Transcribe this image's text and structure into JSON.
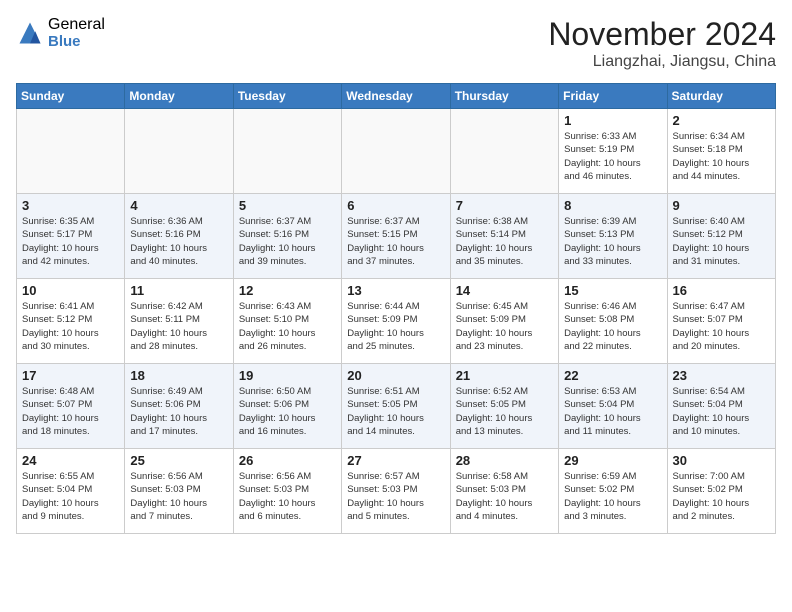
{
  "logo": {
    "general": "General",
    "blue": "Blue"
  },
  "header": {
    "month": "November 2024",
    "location": "Liangzhai, Jiangsu, China"
  },
  "days_of_week": [
    "Sunday",
    "Monday",
    "Tuesday",
    "Wednesday",
    "Thursday",
    "Friday",
    "Saturday"
  ],
  "weeks": [
    [
      {
        "day": "",
        "info": ""
      },
      {
        "day": "",
        "info": ""
      },
      {
        "day": "",
        "info": ""
      },
      {
        "day": "",
        "info": ""
      },
      {
        "day": "",
        "info": ""
      },
      {
        "day": "1",
        "info": "Sunrise: 6:33 AM\nSunset: 5:19 PM\nDaylight: 10 hours\nand 46 minutes."
      },
      {
        "day": "2",
        "info": "Sunrise: 6:34 AM\nSunset: 5:18 PM\nDaylight: 10 hours\nand 44 minutes."
      }
    ],
    [
      {
        "day": "3",
        "info": "Sunrise: 6:35 AM\nSunset: 5:17 PM\nDaylight: 10 hours\nand 42 minutes."
      },
      {
        "day": "4",
        "info": "Sunrise: 6:36 AM\nSunset: 5:16 PM\nDaylight: 10 hours\nand 40 minutes."
      },
      {
        "day": "5",
        "info": "Sunrise: 6:37 AM\nSunset: 5:16 PM\nDaylight: 10 hours\nand 39 minutes."
      },
      {
        "day": "6",
        "info": "Sunrise: 6:37 AM\nSunset: 5:15 PM\nDaylight: 10 hours\nand 37 minutes."
      },
      {
        "day": "7",
        "info": "Sunrise: 6:38 AM\nSunset: 5:14 PM\nDaylight: 10 hours\nand 35 minutes."
      },
      {
        "day": "8",
        "info": "Sunrise: 6:39 AM\nSunset: 5:13 PM\nDaylight: 10 hours\nand 33 minutes."
      },
      {
        "day": "9",
        "info": "Sunrise: 6:40 AM\nSunset: 5:12 PM\nDaylight: 10 hours\nand 31 minutes."
      }
    ],
    [
      {
        "day": "10",
        "info": "Sunrise: 6:41 AM\nSunset: 5:12 PM\nDaylight: 10 hours\nand 30 minutes."
      },
      {
        "day": "11",
        "info": "Sunrise: 6:42 AM\nSunset: 5:11 PM\nDaylight: 10 hours\nand 28 minutes."
      },
      {
        "day": "12",
        "info": "Sunrise: 6:43 AM\nSunset: 5:10 PM\nDaylight: 10 hours\nand 26 minutes."
      },
      {
        "day": "13",
        "info": "Sunrise: 6:44 AM\nSunset: 5:09 PM\nDaylight: 10 hours\nand 25 minutes."
      },
      {
        "day": "14",
        "info": "Sunrise: 6:45 AM\nSunset: 5:09 PM\nDaylight: 10 hours\nand 23 minutes."
      },
      {
        "day": "15",
        "info": "Sunrise: 6:46 AM\nSunset: 5:08 PM\nDaylight: 10 hours\nand 22 minutes."
      },
      {
        "day": "16",
        "info": "Sunrise: 6:47 AM\nSunset: 5:07 PM\nDaylight: 10 hours\nand 20 minutes."
      }
    ],
    [
      {
        "day": "17",
        "info": "Sunrise: 6:48 AM\nSunset: 5:07 PM\nDaylight: 10 hours\nand 18 minutes."
      },
      {
        "day": "18",
        "info": "Sunrise: 6:49 AM\nSunset: 5:06 PM\nDaylight: 10 hours\nand 17 minutes."
      },
      {
        "day": "19",
        "info": "Sunrise: 6:50 AM\nSunset: 5:06 PM\nDaylight: 10 hours\nand 16 minutes."
      },
      {
        "day": "20",
        "info": "Sunrise: 6:51 AM\nSunset: 5:05 PM\nDaylight: 10 hours\nand 14 minutes."
      },
      {
        "day": "21",
        "info": "Sunrise: 6:52 AM\nSunset: 5:05 PM\nDaylight: 10 hours\nand 13 minutes."
      },
      {
        "day": "22",
        "info": "Sunrise: 6:53 AM\nSunset: 5:04 PM\nDaylight: 10 hours\nand 11 minutes."
      },
      {
        "day": "23",
        "info": "Sunrise: 6:54 AM\nSunset: 5:04 PM\nDaylight: 10 hours\nand 10 minutes."
      }
    ],
    [
      {
        "day": "24",
        "info": "Sunrise: 6:55 AM\nSunset: 5:04 PM\nDaylight: 10 hours\nand 9 minutes."
      },
      {
        "day": "25",
        "info": "Sunrise: 6:56 AM\nSunset: 5:03 PM\nDaylight: 10 hours\nand 7 minutes."
      },
      {
        "day": "26",
        "info": "Sunrise: 6:56 AM\nSunset: 5:03 PM\nDaylight: 10 hours\nand 6 minutes."
      },
      {
        "day": "27",
        "info": "Sunrise: 6:57 AM\nSunset: 5:03 PM\nDaylight: 10 hours\nand 5 minutes."
      },
      {
        "day": "28",
        "info": "Sunrise: 6:58 AM\nSunset: 5:03 PM\nDaylight: 10 hours\nand 4 minutes."
      },
      {
        "day": "29",
        "info": "Sunrise: 6:59 AM\nSunset: 5:02 PM\nDaylight: 10 hours\nand 3 minutes."
      },
      {
        "day": "30",
        "info": "Sunrise: 7:00 AM\nSunset: 5:02 PM\nDaylight: 10 hours\nand 2 minutes."
      }
    ]
  ]
}
